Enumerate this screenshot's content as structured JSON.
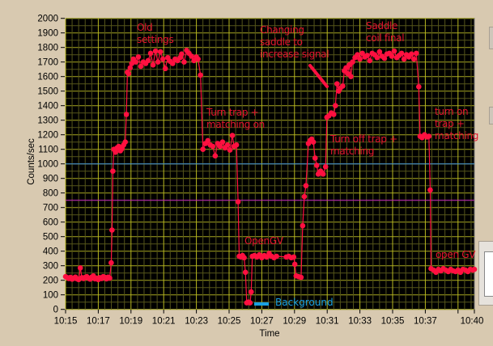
{
  "chart_data": {
    "type": "line",
    "title": "",
    "xlabel": "Time",
    "ylabel": "Counts/sec",
    "xlim_minutes_from_1015": [
      0,
      25
    ],
    "ylim": [
      0,
      2000
    ],
    "x_tick_labels": [
      "10:15",
      "10:17",
      "10:19",
      "10:21",
      "10:23",
      "10:25",
      "10:27",
      "10:29",
      "10:31",
      "10:33",
      "10:35",
      "10:37",
      "10:40"
    ],
    "x_tick_minutes": [
      0,
      2,
      4,
      6,
      8,
      10,
      12,
      14,
      16,
      18,
      20,
      22,
      25
    ],
    "x_unlabeled_ticks": [
      24
    ],
    "y_ticks": [
      0,
      100,
      200,
      300,
      400,
      500,
      600,
      700,
      800,
      900,
      1000,
      1100,
      1200,
      1300,
      1400,
      1500,
      1600,
      1700,
      1800,
      1900,
      2000
    ],
    "grid": true,
    "reference_lines": [
      {
        "value": 1000,
        "color": "#3a8fe0"
      },
      {
        "value": 750,
        "color": "#c020c0"
      }
    ],
    "series": [
      {
        "name": "Counts",
        "color": "#ff1040",
        "points": [
          [
            0,
            225
          ],
          [
            0.1,
            218
          ],
          [
            0.2,
            212
          ],
          [
            0.3,
            220
          ],
          [
            0.4,
            208
          ],
          [
            0.5,
            215
          ],
          [
            0.6,
            222
          ],
          [
            0.7,
            210
          ],
          [
            0.8,
            205
          ],
          [
            0.9,
            285
          ],
          [
            1.0,
            218
          ],
          [
            1.1,
            212
          ],
          [
            1.2,
            220
          ],
          [
            1.3,
            225
          ],
          [
            1.4,
            215
          ],
          [
            1.5,
            208
          ],
          [
            1.6,
            222
          ],
          [
            1.7,
            230
          ],
          [
            1.8,
            210
          ],
          [
            1.9,
            215
          ],
          [
            2.0,
            205
          ],
          [
            2.1,
            218
          ],
          [
            2.2,
            212
          ],
          [
            2.3,
            225
          ],
          [
            2.4,
            220
          ],
          [
            2.5,
            210
          ],
          [
            2.6,
            222
          ],
          [
            2.7,
            215
          ],
          [
            2.79,
            320
          ],
          [
            2.84,
            545
          ],
          [
            2.89,
            950
          ],
          [
            2.95,
            1100
          ],
          [
            3.05,
            1080
          ],
          [
            3.15,
            1110
          ],
          [
            3.25,
            1120
          ],
          [
            3.35,
            1090
          ],
          [
            3.45,
            1105
          ],
          [
            3.55,
            1130
          ],
          [
            3.65,
            1150
          ],
          [
            3.72,
            1340
          ],
          [
            3.78,
            1630
          ],
          [
            3.85,
            1620
          ],
          [
            3.95,
            1660
          ],
          [
            4.05,
            1690
          ],
          [
            4.15,
            1720
          ],
          [
            4.3,
            1700
          ],
          [
            4.45,
            1735
          ],
          [
            4.6,
            1670
          ],
          [
            4.75,
            1700
          ],
          [
            4.9,
            1690
          ],
          [
            5.05,
            1710
          ],
          [
            5.2,
            1760
          ],
          [
            5.35,
            1680
          ],
          [
            5.5,
            1775
          ],
          [
            5.65,
            1700
          ],
          [
            5.8,
            1770
          ],
          [
            5.95,
            1720
          ],
          [
            6.1,
            1655
          ],
          [
            6.25,
            1730
          ],
          [
            6.4,
            1705
          ],
          [
            6.55,
            1690
          ],
          [
            6.7,
            1720
          ],
          [
            6.85,
            1710
          ],
          [
            7.0,
            1730
          ],
          [
            7.1,
            1755
          ],
          [
            7.25,
            1700
          ],
          [
            7.4,
            1780
          ],
          [
            7.55,
            1760
          ],
          [
            7.7,
            1740
          ],
          [
            7.85,
            1710
          ],
          [
            8.0,
            1735
          ],
          [
            8.1,
            1720
          ],
          [
            8.25,
            1610
          ],
          [
            8.4,
            1100
          ],
          [
            8.55,
            1140
          ],
          [
            8.7,
            1160
          ],
          [
            8.85,
            1130
          ],
          [
            9.0,
            1120
          ],
          [
            9.15,
            1055
          ],
          [
            9.3,
            1140
          ],
          [
            9.45,
            1120
          ],
          [
            9.6,
            1150
          ],
          [
            9.75,
            1110
          ],
          [
            9.9,
            1130
          ],
          [
            10.05,
            1095
          ],
          [
            10.2,
            1195
          ],
          [
            10.3,
            1120
          ],
          [
            10.45,
            1130
          ],
          [
            10.55,
            740
          ],
          [
            10.62,
            365
          ],
          [
            10.72,
            360
          ],
          [
            10.82,
            370
          ],
          [
            10.92,
            355
          ],
          [
            11.0,
            255
          ],
          [
            11.08,
            45
          ],
          [
            11.18,
            50
          ],
          [
            11.28,
            45
          ],
          [
            11.35,
            120
          ],
          [
            11.42,
            365
          ],
          [
            11.55,
            370
          ],
          [
            11.7,
            360
          ],
          [
            11.85,
            375
          ],
          [
            12.0,
            355
          ],
          [
            12.15,
            370
          ],
          [
            12.3,
            360
          ],
          [
            12.45,
            385
          ],
          [
            12.6,
            365
          ],
          [
            12.75,
            355
          ],
          [
            12.9,
            365
          ],
          [
            13.5,
            360
          ],
          [
            13.65,
            365
          ],
          [
            13.8,
            355
          ],
          [
            13.95,
            360
          ],
          [
            14.02,
            310
          ],
          [
            14.1,
            230
          ],
          [
            14.25,
            225
          ],
          [
            14.4,
            220
          ],
          [
            14.5,
            575
          ],
          [
            14.6,
            775
          ],
          [
            14.7,
            850
          ],
          [
            14.85,
            1140
          ],
          [
            14.95,
            1160
          ],
          [
            15.05,
            1170
          ],
          [
            15.15,
            1150
          ],
          [
            15.26,
            1040
          ],
          [
            15.36,
            990
          ],
          [
            15.45,
            930
          ],
          [
            15.6,
            950
          ],
          [
            15.75,
            930
          ],
          [
            15.9,
            980
          ],
          [
            15.98,
            1320
          ],
          [
            16.1,
            1330
          ],
          [
            16.25,
            1350
          ],
          [
            16.4,
            1340
          ],
          [
            16.5,
            1400
          ],
          [
            16.6,
            1550
          ],
          [
            16.7,
            1500
          ],
          [
            16.8,
            1520
          ],
          [
            16.95,
            1535
          ],
          [
            17.05,
            1640
          ],
          [
            17.15,
            1660
          ],
          [
            17.25,
            1620
          ],
          [
            17.35,
            1680
          ],
          [
            17.45,
            1600
          ],
          [
            17.55,
            1700
          ],
          [
            17.7,
            1730
          ],
          [
            17.85,
            1750
          ],
          [
            18.0,
            1720
          ],
          [
            18.15,
            1760
          ],
          [
            18.3,
            1735
          ],
          [
            18.45,
            1745
          ],
          [
            18.6,
            1710
          ],
          [
            18.75,
            1760
          ],
          [
            18.9,
            1750
          ],
          [
            19.05,
            1730
          ],
          [
            19.2,
            1770
          ],
          [
            19.35,
            1740
          ],
          [
            19.5,
            1725
          ],
          [
            19.65,
            1755
          ],
          [
            19.8,
            1760
          ],
          [
            19.95,
            1740
          ],
          [
            20.1,
            1775
          ],
          [
            20.25,
            1730
          ],
          [
            20.4,
            1745
          ],
          [
            20.55,
            1760
          ],
          [
            20.7,
            1720
          ],
          [
            20.85,
            1750
          ],
          [
            21.0,
            1735
          ],
          [
            21.15,
            1755
          ],
          [
            21.3,
            1720
          ],
          [
            21.45,
            1760
          ],
          [
            21.6,
            1530
          ],
          [
            21.68,
            1190
          ],
          [
            21.8,
            1180
          ],
          [
            21.95,
            1200
          ],
          [
            22.1,
            1185
          ],
          [
            22.22,
            1190
          ],
          [
            22.3,
            820
          ],
          [
            22.35,
            280
          ],
          [
            22.5,
            270
          ],
          [
            22.65,
            255
          ],
          [
            22.8,
            275
          ],
          [
            22.95,
            265
          ],
          [
            23.1,
            280
          ],
          [
            23.25,
            270
          ],
          [
            23.4,
            260
          ],
          [
            23.55,
            275
          ],
          [
            23.7,
            265
          ],
          [
            23.85,
            260
          ],
          [
            24.0,
            270
          ],
          [
            24.15,
            255
          ],
          [
            24.3,
            275
          ],
          [
            24.45,
            270
          ],
          [
            24.6,
            260
          ],
          [
            24.75,
            275
          ],
          [
            24.9,
            270
          ],
          [
            25.0,
            275
          ]
        ]
      }
    ],
    "annotations": {
      "old_settings": "Old\nsettings",
      "turn_trap_on": "Turn trap +\nmatching on",
      "changing_saddle": "Changing\nsaddle to\nincrease signal",
      "saddle_final": "Saddle\ncoil final",
      "turn_off_trap": "Turn off trap +\nmatching",
      "turn_on_trap": "turn on\ntrap +\nmatching",
      "open_gv_1": "OpenGV",
      "open_gv_2": "open GV",
      "background": "Background"
    }
  }
}
